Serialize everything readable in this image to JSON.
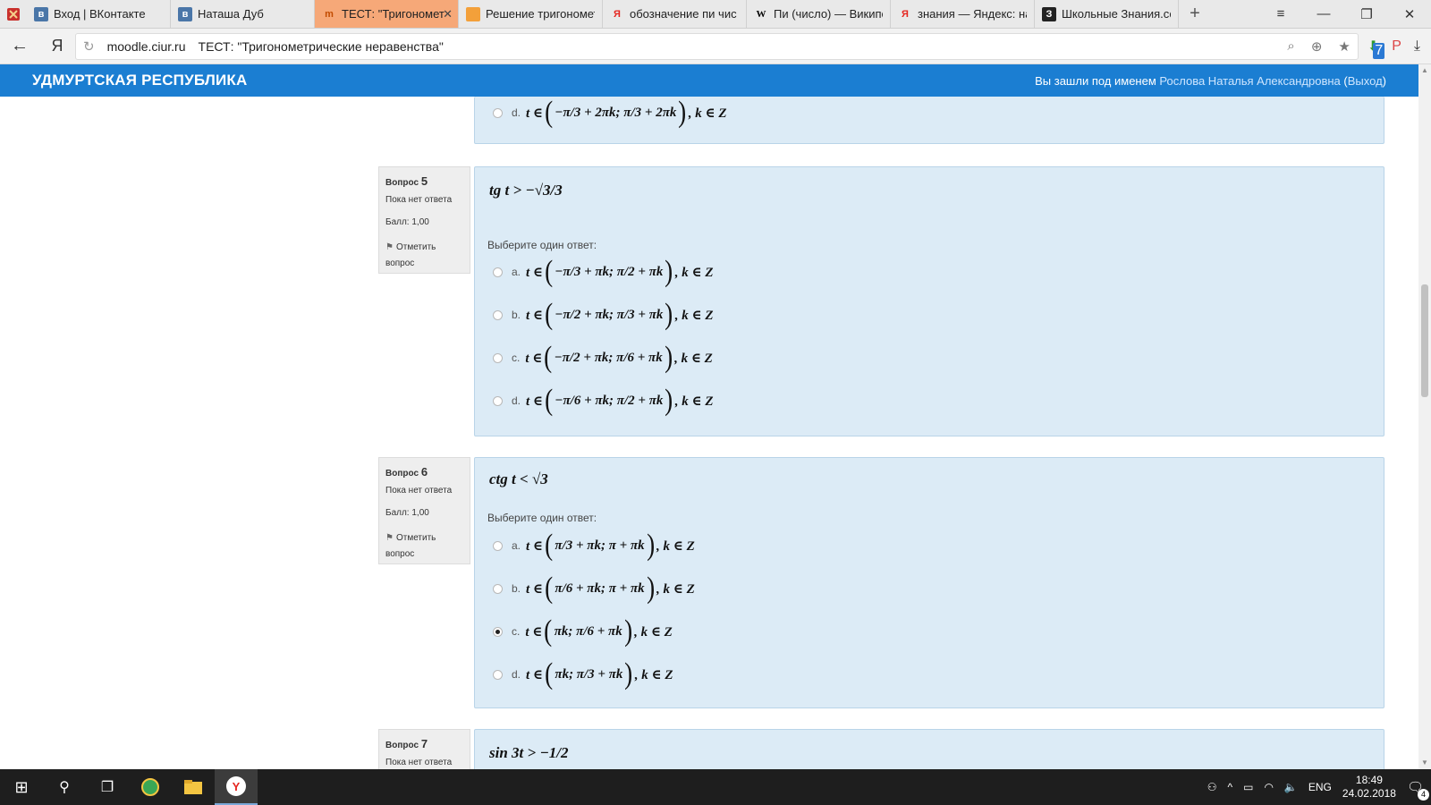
{
  "browser": {
    "tabs": [
      {
        "title": "Вход | ВКонтакте",
        "favicon": "vk-icon",
        "fav_text": "в"
      },
      {
        "title": "Наташа Дуб",
        "favicon": "vk-icon",
        "fav_text": "в"
      },
      {
        "title": "ТЕСТ: \"Тригономет",
        "favicon": "moodle-icon",
        "fav_text": "m",
        "active": true,
        "close": "✕"
      },
      {
        "title": "Решение тригономет",
        "favicon": "orange-circle-icon",
        "fav_text": ""
      },
      {
        "title": "обозначение пи чис",
        "favicon": "yandex-icon",
        "fav_text": "Я"
      },
      {
        "title": "Пи (число) — Википе",
        "favicon": "wikipedia-icon",
        "fav_text": "W"
      },
      {
        "title": "знания — Яндекс: на",
        "favicon": "yandex-icon",
        "fav_text": "Я"
      },
      {
        "title": "Школьные Знания.со",
        "favicon": "znania-icon",
        "fav_text": "З"
      }
    ],
    "new_tab": "+",
    "window_controls": {
      "menu": "≡",
      "minimize": "—",
      "restore": "❐",
      "close": "✕"
    },
    "address": {
      "back": "←",
      "yandex": "Я",
      "reload": "↻",
      "host": "moodle.ciur.ru",
      "page_title": "ТЕСТ: \"Тригонометрические неравенства\"",
      "icon_search": "⌕",
      "icon_protect": "⊕",
      "icon_star": "★"
    },
    "ext": {
      "download_badge": "7",
      "download": "⬇",
      "pdf": "P",
      "downloads": "⤓"
    }
  },
  "site": {
    "name": "УДМУРТСКАЯ РЕСПУБЛИКА",
    "login_prefix": "Вы зашли под именем",
    "user_name": "Рослова Наталья Александровна",
    "logout": "Выход",
    "open_paren": "(",
    "close_paren": ")"
  },
  "prev_answer": {
    "letter": "d.",
    "formula": [
      "t ∈",
      "(",
      "−π/3 + 2πk; π/3 + 2πk",
      ")",
      ", k ∈ Z"
    ]
  },
  "questions": [
    {
      "label": "Вопрос",
      "number": "5",
      "state": "Пока нет ответа",
      "grade": "Балл: 1,00",
      "flag": "Отметить вопрос",
      "text": "tg t > −√3/3",
      "prompt": "Выберите один ответ:",
      "answers": [
        {
          "letter": "a.",
          "inner": "−π/3 + πk; π/2 + πk",
          "checked": false
        },
        {
          "letter": "b.",
          "inner": "−π/2 + πk; π/3 + πk",
          "checked": false
        },
        {
          "letter": "c.",
          "inner": "−π/2 + πk; π/6 + πk",
          "checked": false
        },
        {
          "letter": "d.",
          "inner": "−π/6 + πk; π/2 + πk",
          "checked": false
        }
      ]
    },
    {
      "label": "Вопрос",
      "number": "6",
      "state": "Пока нет ответа",
      "grade": "Балл: 1,00",
      "flag": "Отметить вопрос",
      "text": "ctg t < √3",
      "prompt": "Выберите один ответ:",
      "answers": [
        {
          "letter": "a.",
          "inner": "π/3 + πk; π + πk",
          "checked": false
        },
        {
          "letter": "b.",
          "inner": "π/6 + πk; π + πk",
          "checked": false
        },
        {
          "letter": "c.",
          "inner": "πk; π/6 + πk",
          "checked": true
        },
        {
          "letter": "d.",
          "inner": "πk; π/3 + πk",
          "checked": false
        }
      ]
    },
    {
      "label": "Вопрос",
      "number": "7",
      "state": "Пока нет ответа",
      "text": "sin 3t > −1/2"
    }
  ],
  "formula_parts": {
    "prefix": "t ∈",
    "suffix": ", k ∈ Z"
  },
  "taskbar": {
    "start": "⊞",
    "search": "⚲",
    "taskview": "❐",
    "tray": {
      "person": "⚇",
      "chevron": "^",
      "battery": "▭",
      "wifi": "◠",
      "volume": "🔈",
      "lang": "ENG",
      "time": "18:49",
      "date": "24.02.2018",
      "notif": "🗨",
      "notif_count": "4"
    }
  }
}
